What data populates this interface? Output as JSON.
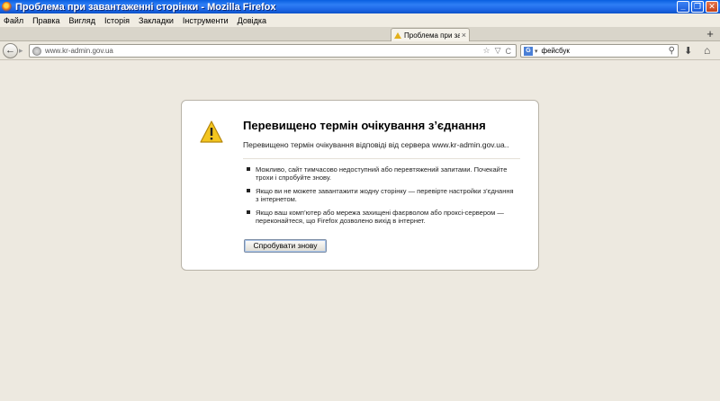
{
  "window": {
    "title": "Проблема при завантаженні сторінки - Mozilla Firefox",
    "controls": {
      "minimize": "_",
      "restore": "❐",
      "close": "✕"
    }
  },
  "menu": [
    "Файл",
    "Правка",
    "Вигляд",
    "Історія",
    "Закладки",
    "Інструменти",
    "Довідка"
  ],
  "tab": {
    "label": "Проблема при за...",
    "close": "×"
  },
  "newtab": "+",
  "nav": {
    "back": "←",
    "forward": "▸",
    "url": "www.kr-admin.gov.ua",
    "bookmark_star": "☆",
    "history_dropdown": "▽",
    "reload": "C",
    "search_engine": "G",
    "search_value": "фейсбук",
    "search_go": "⚲",
    "downloads": "⬇",
    "home": "⌂"
  },
  "error": {
    "title": "Перевищено термін очікування з’єднання",
    "short_desc": "Перевищено термін очікування відповіді від сервера www.kr-admin.gov.ua..",
    "items": [
      "Можливо, сайт тимчасово недоступний або перевтяжений запитами. Почекайте трохи і спробуйте знову.",
      "Якщо ви не можете завантажити жодну сторінку — перевірте настройки з’єднання з інтернетом.",
      "Якщо ваш комп’ютер або мережа захищені фаєрволом або проксі-сервером — переконайтеся, що Firefox дозволено вихід в інтернет."
    ],
    "retry_label": "Спробувати знову"
  },
  "colors": {
    "titlebar": "#1d67e6",
    "background": "#ede9e0",
    "warning": "#e3b01b"
  }
}
